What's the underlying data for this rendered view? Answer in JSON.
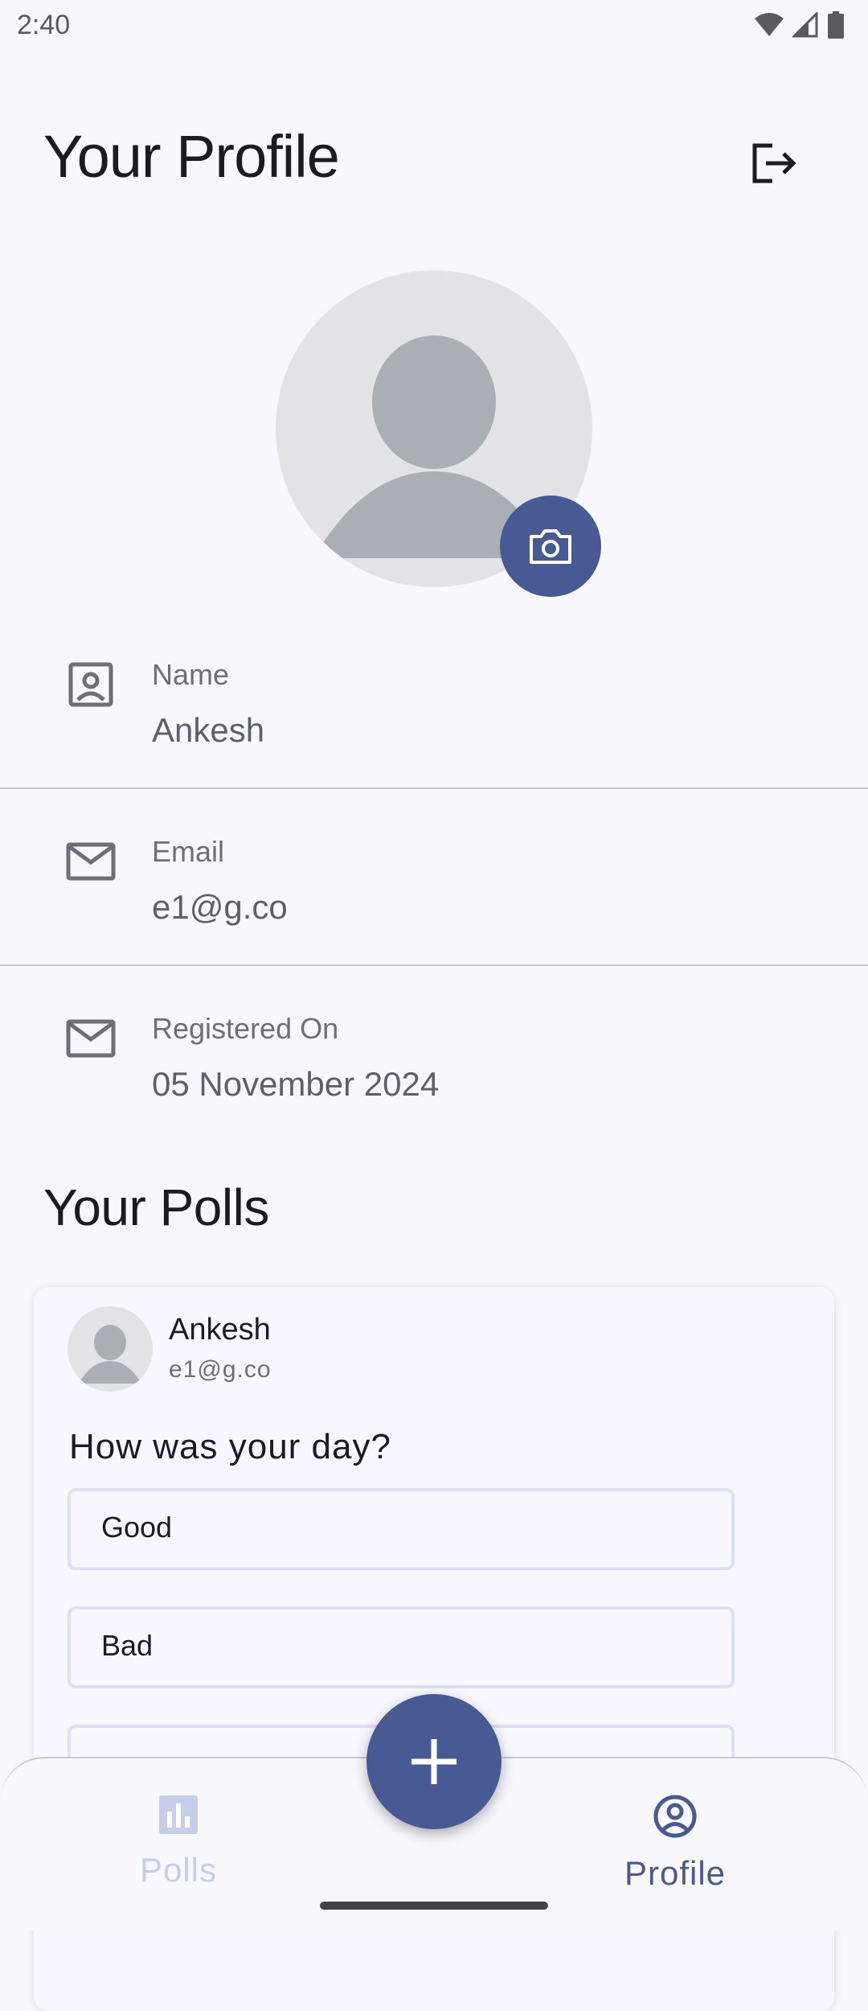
{
  "status_bar": {
    "time": "2:40"
  },
  "header": {
    "title": "Your Profile"
  },
  "profile": {
    "fields": [
      {
        "label": "Name",
        "value": "Ankesh"
      },
      {
        "label": "Email",
        "value": "e1@g.co"
      },
      {
        "label": "Registered On",
        "value": "05 November 2024"
      }
    ]
  },
  "polls_section": {
    "title": "Your Polls",
    "polls": [
      {
        "author": "Ankesh",
        "email": "e1@g.co",
        "question": "How was your day?",
        "options": [
          "Good",
          "Bad"
        ]
      }
    ]
  },
  "bottom_nav": {
    "items": [
      {
        "label": "Polls",
        "icon": "bar-chart-icon",
        "selected": false
      },
      {
        "label": "Profile",
        "icon": "account-circle-icon",
        "selected": true
      }
    ],
    "fab_icon": "plus-icon"
  },
  "colors": {
    "accent": "#485a93",
    "background": "#f8f7fc",
    "option_border": "#dcdff5"
  }
}
